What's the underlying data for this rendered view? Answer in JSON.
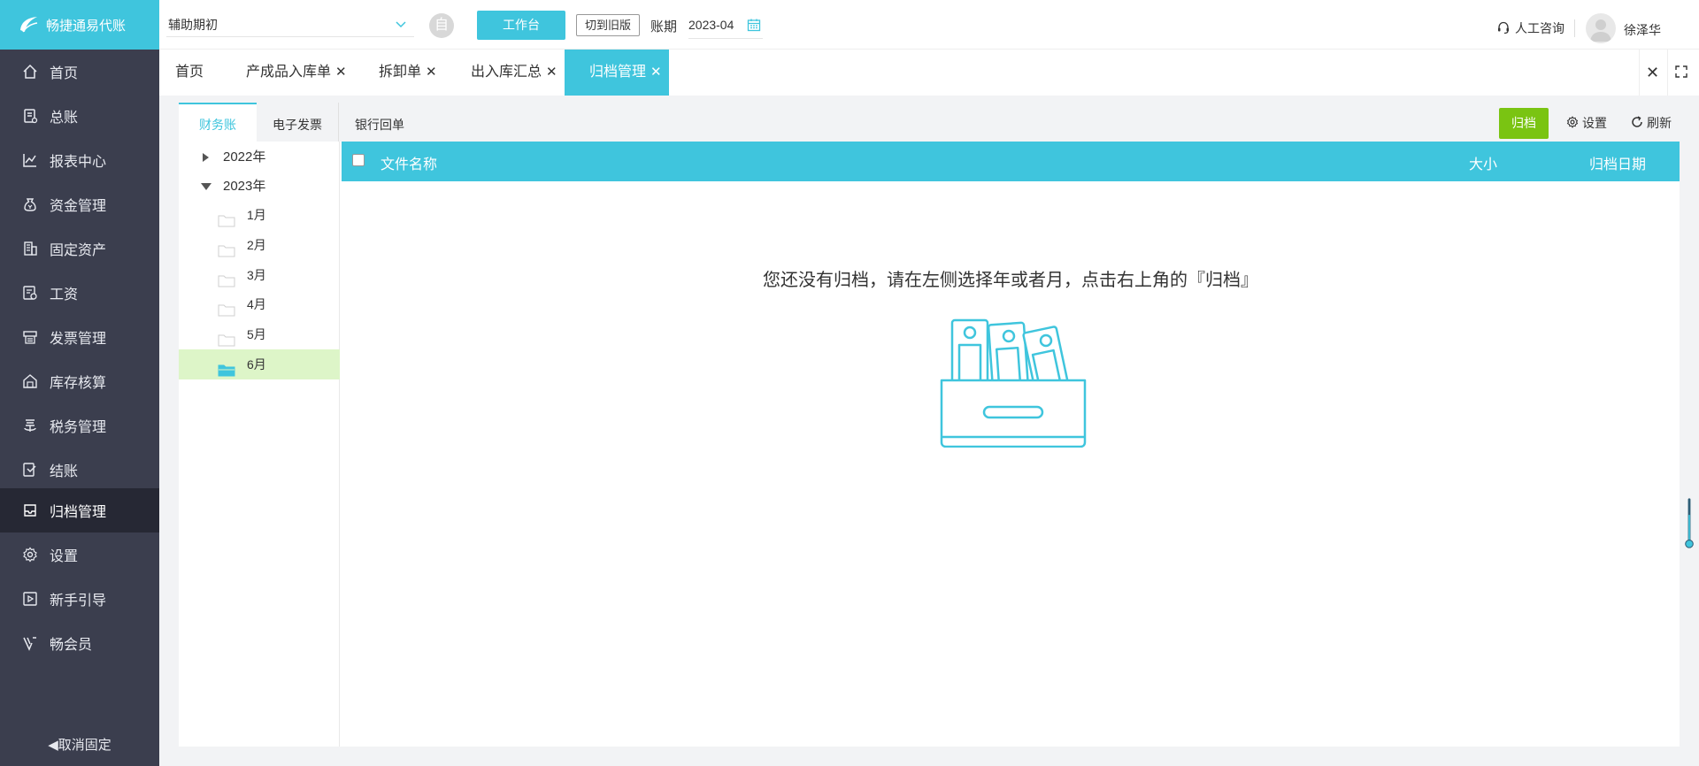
{
  "brand": {
    "name": "畅捷通易代账"
  },
  "sidebar": {
    "items": [
      {
        "label": "首页",
        "icon": "home-icon"
      },
      {
        "label": "总账",
        "icon": "ledger-icon"
      },
      {
        "label": "报表中心",
        "icon": "chart-icon"
      },
      {
        "label": "资金管理",
        "icon": "money-bag-icon"
      },
      {
        "label": "固定资产",
        "icon": "asset-icon"
      },
      {
        "label": "工资",
        "icon": "salary-icon"
      },
      {
        "label": "发票管理",
        "icon": "invoice-icon"
      },
      {
        "label": "库存核算",
        "icon": "warehouse-icon"
      },
      {
        "label": "税务管理",
        "icon": "tax-icon"
      },
      {
        "label": "结账",
        "icon": "closing-icon"
      },
      {
        "label": "归档管理",
        "icon": "archive-icon"
      },
      {
        "label": "设置",
        "icon": "gear-icon"
      },
      {
        "label": "新手引导",
        "icon": "guide-icon"
      },
      {
        "label": "畅会员",
        "icon": "vip-icon"
      }
    ],
    "active_index": 10,
    "unpin_label": "取消固定"
  },
  "topbar": {
    "period_select": "辅助期初",
    "circle_btn_label": "自",
    "workbench_label": "工作台",
    "old_version_label": "切到旧版",
    "period_label": "账期",
    "period_value": "2023-04",
    "help_label": "人工咨询",
    "username": "徐泽华"
  },
  "tabs": [
    {
      "label": "首页",
      "closable": false
    },
    {
      "label": "产成品入库单",
      "closable": true
    },
    {
      "label": "拆卸单",
      "closable": true
    },
    {
      "label": "出入库汇总",
      "closable": true
    },
    {
      "label": "归档管理",
      "closable": true,
      "active": true
    }
  ],
  "subtabs": [
    "财务账",
    "电子发票",
    "银行回单"
  ],
  "toolbar": {
    "archive_label": "归档",
    "settings_label": "设置",
    "refresh_label": "刷新"
  },
  "tree": {
    "years": [
      "2022年",
      "2023年"
    ],
    "months": [
      "1月",
      "2月",
      "3月",
      "4月",
      "5月",
      "6月"
    ],
    "selected_month": "6月"
  },
  "grid": {
    "columns": [
      "文件名称",
      "大小",
      "归档日期"
    ],
    "empty_message": "您还没有归档，请在左侧选择年或者月，点击右上角的『归档』"
  },
  "colors": {
    "accent": "#3fc5dd",
    "sidebar_bg": "#3b3e4e",
    "archive_btn": "#7ac412",
    "selected_row": "#ddf5c8"
  }
}
